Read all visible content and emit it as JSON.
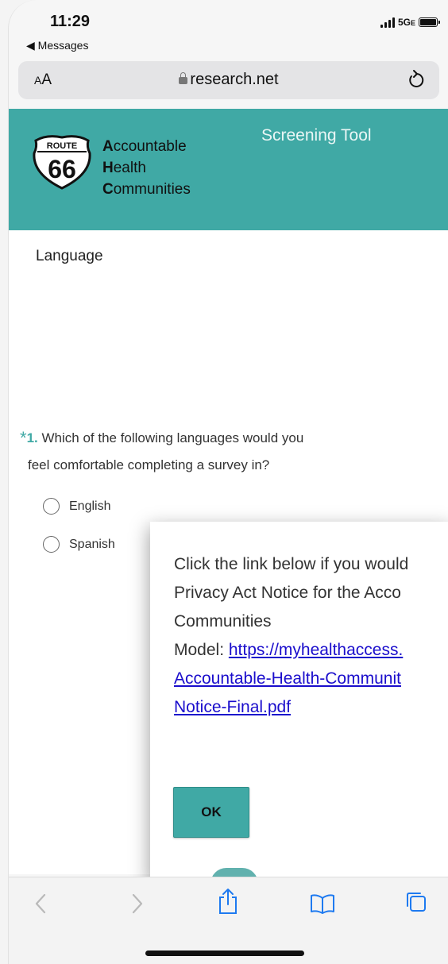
{
  "status_bar": {
    "time": "11:29",
    "back_label": "◀ Messages",
    "network": "5G",
    "network_suffix": "E"
  },
  "address_bar": {
    "text_size_small": "A",
    "text_size_large": "A",
    "url": "research.net",
    "lock_icon": "lock-icon",
    "reload_icon": "reload-icon"
  },
  "header": {
    "logo_top": "ROUTE",
    "logo_number": "66",
    "org_lines": [
      {
        "initial": "A",
        "rest": "ccountable"
      },
      {
        "initial": "H",
        "rest": "ealth"
      },
      {
        "initial": "C",
        "rest": "ommunities"
      }
    ],
    "title": "Screening Tool"
  },
  "section": {
    "label": "Language"
  },
  "question": {
    "required_mark": "*",
    "number": "1.",
    "text_line1": "Which of the following languages would you",
    "text_line2": "feel comfortable completing a survey in?",
    "options": [
      "English",
      "Spanish"
    ]
  },
  "modal": {
    "line1": "Click the link below if you would",
    "line2": "Privacy Act Notice for the Acco",
    "line3": "Communities",
    "line4_prefix": "Model: ",
    "link_line1": "https://myhealthaccess.",
    "link_line2": "Accountable-Health-Communit",
    "link_line3": "Notice-Final.pdf",
    "ok_label": "OK"
  },
  "colors": {
    "brand_teal": "#40a9a5",
    "link_blue": "#1a0dcc"
  },
  "toolbar": {
    "icons": [
      "back-icon",
      "forward-icon",
      "share-icon",
      "bookmarks-icon",
      "tabs-icon"
    ]
  }
}
